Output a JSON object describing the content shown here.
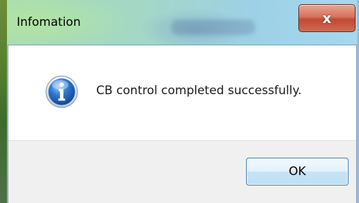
{
  "window": {
    "title": "Infomation",
    "close_glyph": "x"
  },
  "message": {
    "icon": "info-icon",
    "text": "CB control completed successfully."
  },
  "buttons": {
    "ok_label": "OK"
  },
  "colors": {
    "titlebar": "#a6d8ef",
    "close_button": "#c24a31",
    "ok_button_border": "#3c7fb1",
    "button_area": "#f0f0f0",
    "info_icon": "#1f5fb8"
  }
}
